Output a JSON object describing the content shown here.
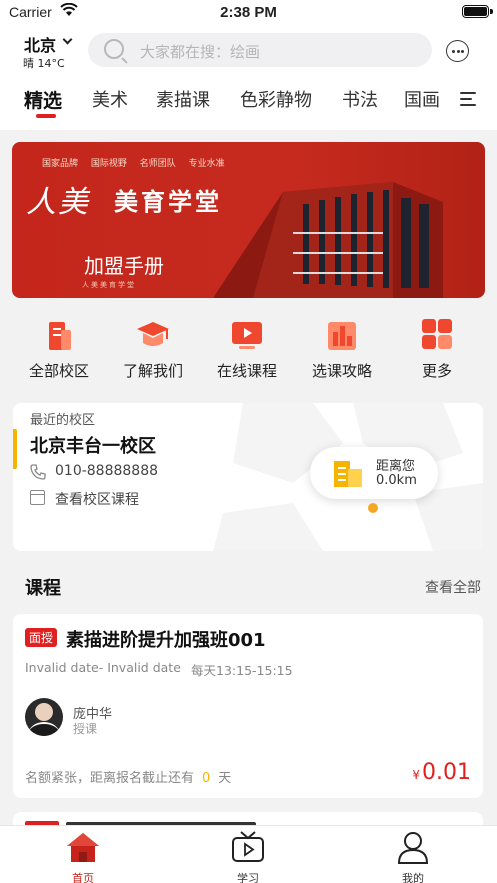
{
  "status_bar": {
    "carrier": "Carrier",
    "time": "2:38 PM"
  },
  "header": {
    "city": "北京",
    "weather": "晴 14°C",
    "search_placeholder": "大家都在搜：绘画"
  },
  "tabs": [
    "精选",
    "美术",
    "素描课",
    "色彩静物",
    "书法",
    "国画"
  ],
  "banner": {
    "tags": [
      "国家品牌",
      "国际视野",
      "名师团队",
      "专业水准"
    ],
    "logo": "人美",
    "title": "美育学堂",
    "subtitle": "加盟手册",
    "small": "人美美育学堂"
  },
  "shortcuts": [
    {
      "label": "全部校区",
      "icon": "building-icon"
    },
    {
      "label": "了解我们",
      "icon": "graduation-cap-icon"
    },
    {
      "label": "在线课程",
      "icon": "video-play-icon"
    },
    {
      "label": "选课攻略",
      "icon": "chart-icon"
    },
    {
      "label": "更多",
      "icon": "grid-icon"
    }
  ],
  "campus": {
    "recent_label": "最近的校区",
    "name": "北京丰台一校区",
    "phone": "010-88888888",
    "view_courses": "查看校区课程",
    "distance_label": "距离您",
    "distance_value": "0.0km"
  },
  "courses_section": {
    "title": "课程",
    "see_all": "查看全部"
  },
  "course": {
    "badge": "面授",
    "title": "素描进阶提升加强班001",
    "dates": "Invalid date- Invalid date",
    "schedule": "每天13:15-15:15",
    "teacher_name": "庞中华",
    "teacher_role": "授课",
    "foot_prefix": "名额紧张，距离报名截止还有",
    "foot_count": "0",
    "foot_suffix": "天",
    "price_symbol": "¥",
    "price": "0.01"
  },
  "tabbar": [
    {
      "label": "首页",
      "icon": "home-icon",
      "active": true
    },
    {
      "label": "学习",
      "icon": "tv-icon",
      "active": false
    },
    {
      "label": "我的",
      "icon": "user-icon",
      "active": false
    }
  ],
  "colors": {
    "accent": "#e02020",
    "banner_red": "#c4261b",
    "highlight": "#f6b400"
  }
}
